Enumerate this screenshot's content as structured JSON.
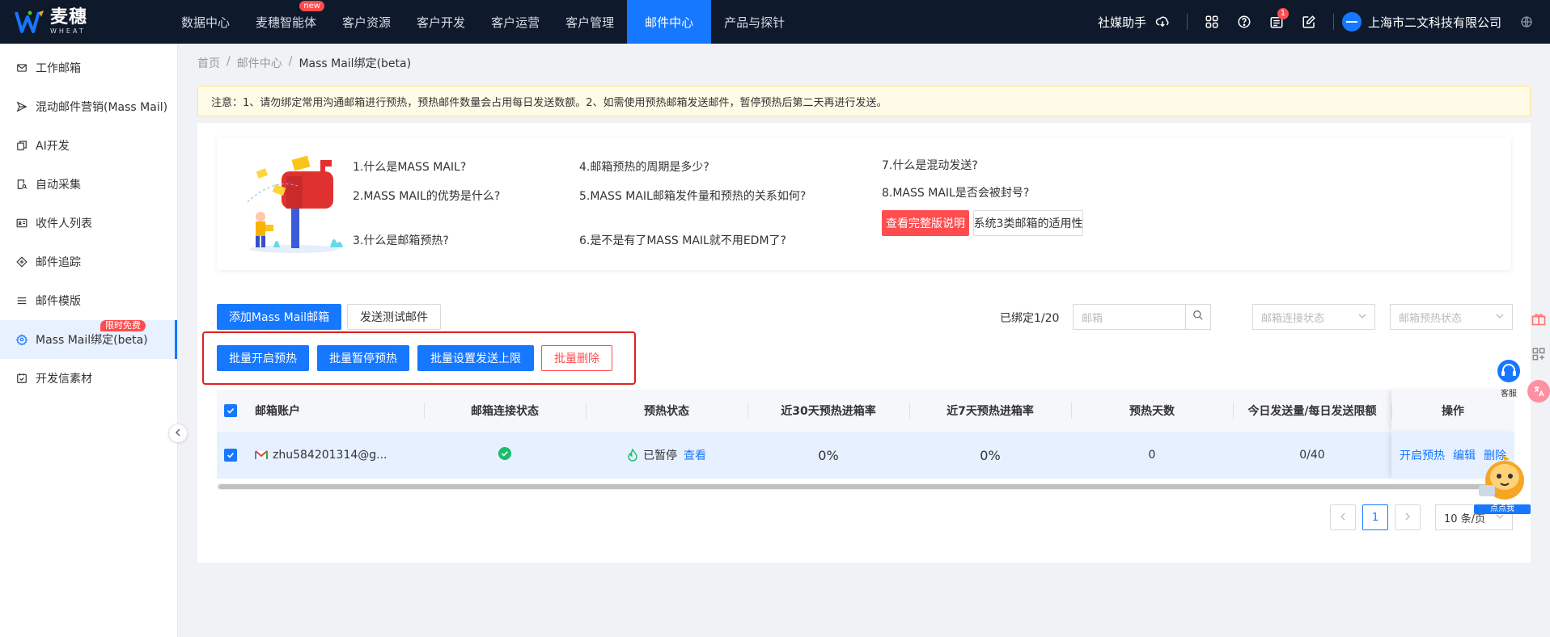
{
  "brand": {
    "name_cn": "麦穗",
    "name_en": "WHEAT"
  },
  "nav": {
    "items": [
      {
        "label": "数据中心"
      },
      {
        "label": "麦穗智能体",
        "badge": "new"
      },
      {
        "label": "客户资源"
      },
      {
        "label": "客户开发"
      },
      {
        "label": "客户运营"
      },
      {
        "label": "客户管理"
      },
      {
        "label": "邮件中心",
        "active": true
      },
      {
        "label": "产品与探针"
      }
    ]
  },
  "header": {
    "social_helper": "社媒助手",
    "notification_count": "1",
    "company": "上海市二文科技有限公司"
  },
  "sidebar": {
    "items": [
      {
        "label": "工作邮箱",
        "icon": "mail-icon"
      },
      {
        "label": "混动邮件营销(Mass Mail)",
        "icon": "send-icon"
      },
      {
        "label": "AI开发",
        "icon": "copy-icon"
      },
      {
        "label": "自动采集",
        "icon": "search-doc-icon"
      },
      {
        "label": "收件人列表",
        "icon": "contact-card-icon"
      },
      {
        "label": "邮件追踪",
        "icon": "target-icon"
      },
      {
        "label": "邮件模版",
        "icon": "list-icon"
      },
      {
        "label": "Mass Mail绑定(beta)",
        "icon": "gear-icon",
        "badge": "限时免费",
        "active": true
      },
      {
        "label": "开发信素材",
        "icon": "checklist-icon"
      }
    ]
  },
  "breadcrumb": {
    "home": "首页",
    "section": "邮件中心",
    "current": "Mass Mail绑定(beta)",
    "sep": "/"
  },
  "notice": "注意：1、请勿绑定常用沟通邮箱进行预热，预热邮件数量会占用每日发送数额。2、如需使用预热邮箱发送邮件，暂停预热后第二天再进行发送。",
  "faq": {
    "q1": "1.什么是MASS MAIL?",
    "q2": "2.MASS MAIL的优势是什么?",
    "q3": "3.什么是邮箱预热?",
    "q4": "4.邮箱预热的周期是多少?",
    "q5": "5.MASS MAIL邮箱发件量和预热的关系如何?",
    "q6": "6.是不是有了MASS MAIL就不用EDM了?",
    "q7": "7.什么是混动发送?",
    "q8": "8.MASS MAIL是否会被封号?",
    "full_btn": "查看完整版说明",
    "suit_btn": "系统3类邮箱的适用性"
  },
  "toolbar": {
    "add_btn": "添加Mass Mail邮箱",
    "test_btn": "发送测试邮件",
    "bound": "已绑定1/20",
    "search_placeholder": "邮箱",
    "conn_status_placeholder": "邮箱连接状态",
    "warm_status_placeholder": "邮箱预热状态"
  },
  "batch": {
    "start": "批量开启预热",
    "pause": "批量暂停预热",
    "limit": "批量设置发送上限",
    "delete": "批量删除"
  },
  "table": {
    "columns": [
      "邮箱账户",
      "邮箱连接状态",
      "预热状态",
      "近30天预热进箱率",
      "近7天预热进箱率",
      "预热天数",
      "今日发送量/每日发送限额",
      "操作"
    ],
    "rows": [
      {
        "email": "zhu584201314@g...",
        "warm_status": "已暂停",
        "view": "查看",
        "rate30": "0%",
        "rate7": "0%",
        "days": "0",
        "send": "0/40",
        "op_start": "开启预热",
        "op_edit": "编辑",
        "op_delete": "删除"
      }
    ]
  },
  "pagination": {
    "page": "1",
    "size": "10 条/页"
  },
  "floating": {
    "service": "客服",
    "mascot": "点点我"
  },
  "colors": {
    "primary": "#1677ff",
    "danger": "#ff4d4f",
    "topbar": "#0e1a2b",
    "success": "#19be6b"
  }
}
